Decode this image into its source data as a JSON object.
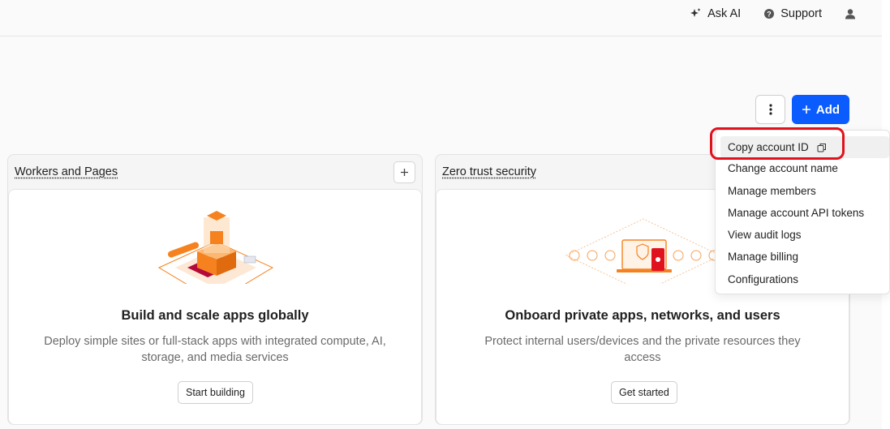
{
  "header": {
    "ask_ai": "Ask AI",
    "support": "Support"
  },
  "actions": {
    "add_label": "Add"
  },
  "cards": [
    {
      "title": "Workers and Pages",
      "heading": "Build and scale apps globally",
      "description": "Deploy simple sites or full-stack apps with integrated compute, AI, storage, and media services",
      "button": "Start building"
    },
    {
      "title": "Zero trust security",
      "heading": "Onboard private apps, networks, and users",
      "description": "Protect internal users/devices and the private resources they access",
      "button": "Get started"
    }
  ],
  "menu": {
    "items": [
      "Copy account ID",
      "Change account name",
      "Manage members",
      "Manage account API tokens",
      "View audit logs",
      "Manage billing",
      "Configurations"
    ]
  },
  "colors": {
    "primary": "#0a5cff",
    "accent_orange": "#f6821f",
    "highlight": "#e0121e"
  }
}
